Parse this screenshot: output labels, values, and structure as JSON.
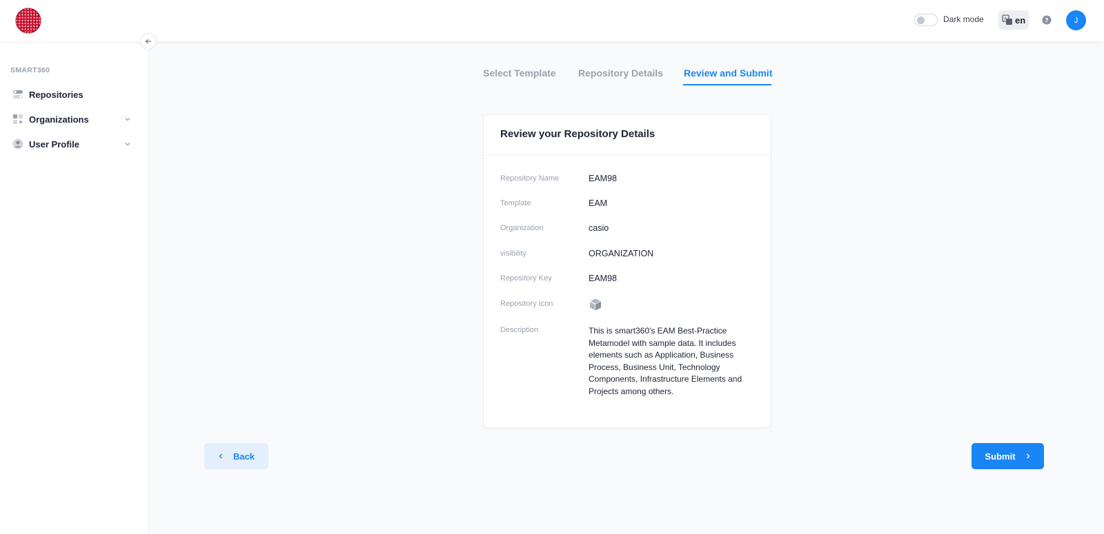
{
  "header": {
    "logo": "globe-logo",
    "dark_mode_label": "Dark mode",
    "dark_mode_on": false,
    "language": "en",
    "avatar_initial": "J",
    "accent_color": "#1a85f5"
  },
  "sidebar": {
    "section_label": "SMART360",
    "items": [
      {
        "label": "Repositories",
        "icon": "toggles-icon",
        "expandable": false
      },
      {
        "label": "Organizations",
        "icon": "grid-plus-icon",
        "expandable": true
      },
      {
        "label": "User Profile",
        "icon": "user-icon",
        "expandable": true
      }
    ]
  },
  "stepper": {
    "steps": [
      "Select Template",
      "Repository Details",
      "Review and Submit"
    ],
    "active_index": 2
  },
  "review": {
    "title": "Review your Repository Details",
    "rows": [
      {
        "label": "Repository Name",
        "value": "EAM98"
      },
      {
        "label": "Template",
        "value": "EAM"
      },
      {
        "label": "Organization",
        "value": "casio"
      },
      {
        "label": "visibility",
        "value": "ORGANIZATION"
      },
      {
        "label": "Repository Key",
        "value": "EAM98"
      },
      {
        "label": "Repository Icon",
        "value": "cube-icon"
      },
      {
        "label": "Description",
        "value": "This is smart360's EAM Best-Practice Metamodel with sample data. It includes elements such as Application, Business Process, Business Unit, Technology Components, Infrastructure Elements and Projects among others."
      }
    ]
  },
  "actions": {
    "back_label": "Back",
    "submit_label": "Submit"
  }
}
